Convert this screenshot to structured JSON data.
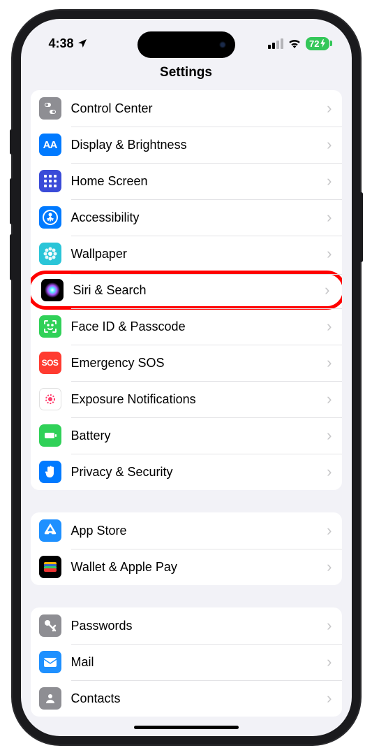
{
  "status": {
    "time": "4:38",
    "battery": "72"
  },
  "header": {
    "title": "Settings"
  },
  "groups": [
    {
      "rows": [
        {
          "id": "control-center",
          "label": "Control Center",
          "iconBg": "#8e8e93",
          "glyph": "switch"
        },
        {
          "id": "display",
          "label": "Display & Brightness",
          "iconBg": "#007aff",
          "glyph": "AA"
        },
        {
          "id": "home-screen",
          "label": "Home Screen",
          "iconBg": "#3a4bd8",
          "glyph": "grid"
        },
        {
          "id": "accessibility",
          "label": "Accessibility",
          "iconBg": "#007aff",
          "glyph": "person"
        },
        {
          "id": "wallpaper",
          "label": "Wallpaper",
          "iconBg": "#2ac5d8",
          "glyph": "flower"
        },
        {
          "id": "siri",
          "label": "Siri & Search",
          "iconBg": "#000",
          "glyph": "siri",
          "highlight": true
        },
        {
          "id": "faceid",
          "label": "Face ID & Passcode",
          "iconBg": "#30d158",
          "glyph": "face"
        },
        {
          "id": "sos",
          "label": "Emergency SOS",
          "iconBg": "#ff3b30",
          "glyph": "SOS"
        },
        {
          "id": "exposure",
          "label": "Exposure Notifications",
          "iconBg": "#ffffff",
          "glyph": "covid"
        },
        {
          "id": "battery",
          "label": "Battery",
          "iconBg": "#30d158",
          "glyph": "battery"
        },
        {
          "id": "privacy",
          "label": "Privacy & Security",
          "iconBg": "#007aff",
          "glyph": "hand"
        }
      ]
    },
    {
      "rows": [
        {
          "id": "appstore",
          "label": "App Store",
          "iconBg": "#1e90ff",
          "glyph": "appstore"
        },
        {
          "id": "wallet",
          "label": "Wallet & Apple Pay",
          "iconBg": "#000",
          "glyph": "wallet"
        }
      ]
    },
    {
      "rows": [
        {
          "id": "passwords",
          "label": "Passwords",
          "iconBg": "#8e8e93",
          "glyph": "key"
        },
        {
          "id": "mail",
          "label": "Mail",
          "iconBg": "#1e90ff",
          "glyph": "mail"
        },
        {
          "id": "contacts",
          "label": "Contacts",
          "iconBg": "#8e8e93",
          "glyph": "contacts"
        }
      ]
    }
  ]
}
